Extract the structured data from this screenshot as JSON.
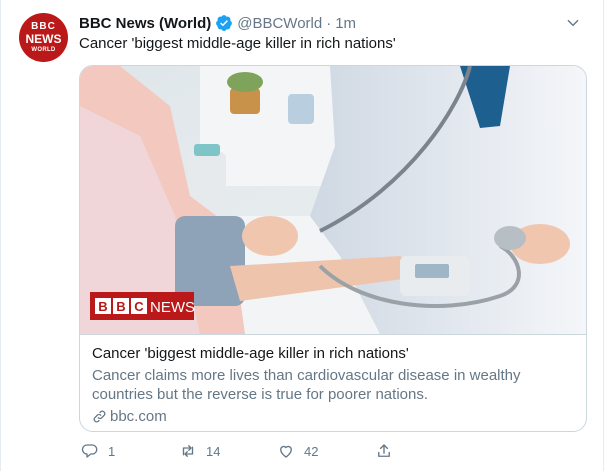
{
  "author": {
    "avatar_text": [
      "BBC",
      "NEWS",
      "WORLD"
    ],
    "name": "BBC News (World)",
    "verified": true,
    "handle": "@BBCWorld",
    "separator": "·",
    "time": "1m"
  },
  "tweet": {
    "text": "Cancer 'biggest middle-age killer in rich nations'"
  },
  "card": {
    "image_logo": "BBC",
    "image_logo_word": "NEWS",
    "title": "Cancer 'biggest middle-age killer in rich nations'",
    "description": "Cancer claims more lives than cardiovascular disease in wealthy countries but the reverse is true for poorer nations.",
    "domain": "bbc.com"
  },
  "actions": {
    "reply_count": "1",
    "retweet_count": "14",
    "like_count": "42"
  },
  "colors": {
    "bbc_red": "#bb1919",
    "verified_blue": "#1da1f2",
    "muted_text": "#657786",
    "border": "#ccd6dd"
  },
  "icons": {
    "verified": "verified-badge-icon",
    "menu": "chevron-down-icon",
    "link": "link-icon",
    "reply": "reply-icon",
    "retweet": "retweet-icon",
    "like": "heart-icon",
    "share": "share-icon"
  }
}
